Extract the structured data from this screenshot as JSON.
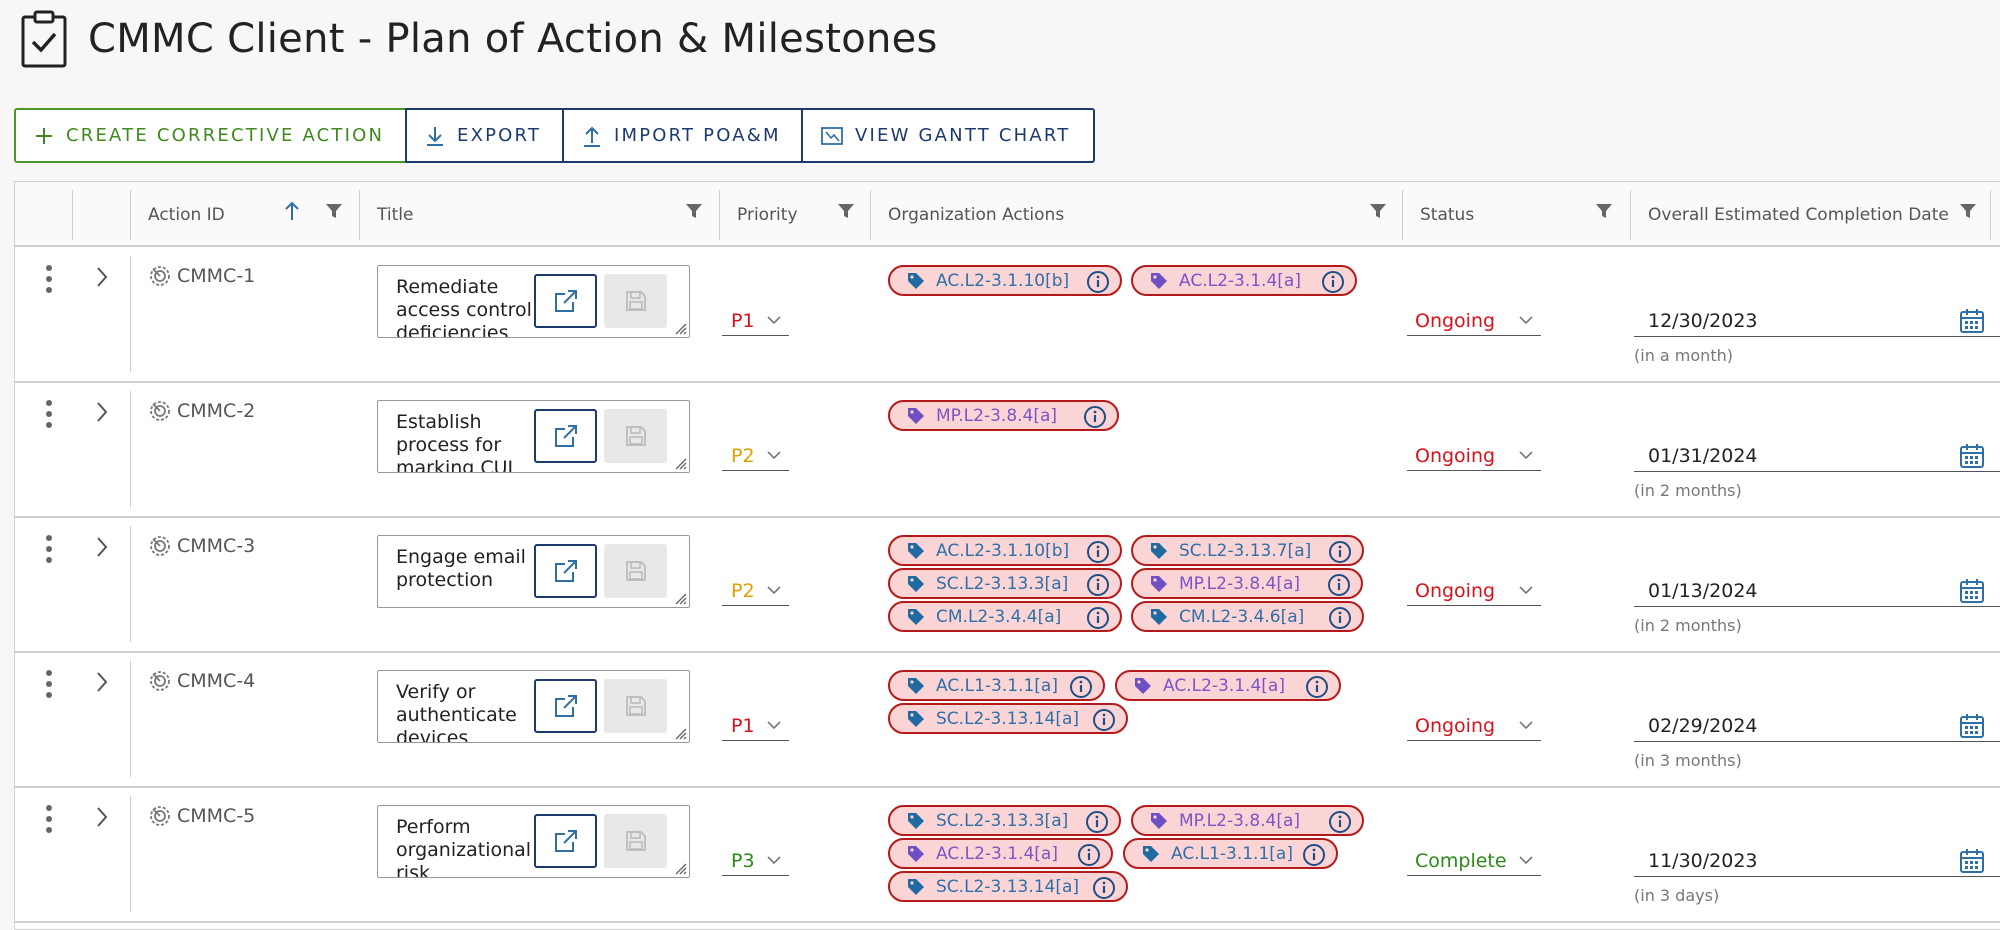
{
  "header": {
    "title": "CMMC Client - Plan of Action & Milestones",
    "icon": "clipboard-check-icon"
  },
  "toolbar": {
    "create_label": "CREATE CORRECTIVE ACTION",
    "export_label": "EXPORT",
    "import_label": "IMPORT POA&M",
    "gantt_label": "VIEW GANTT CHART"
  },
  "columns": {
    "action_id": "Action ID",
    "title": "Title",
    "priority": "Priority",
    "org_actions": "Organization Actions",
    "status": "Status",
    "completion": "Overall Estimated Completion Date"
  },
  "colors": {
    "accent": "#1d3a6e",
    "green": "#3e8a1e",
    "tag_border": "#b51a1a",
    "tag_bg": "#fbd5d5"
  },
  "rows": [
    {
      "id": "CMMC-1",
      "title": "Remediate access control deficiencies",
      "priority": "P1",
      "tags": [
        "AC.L2-3.1.10[b]",
        "AC.L2-3.1.4[a]"
      ],
      "status": "Ongoing",
      "date": "12/30/2023",
      "hint": "(in a month)"
    },
    {
      "id": "CMMC-2",
      "title": "Establish process for marking CUI",
      "priority": "P2",
      "tags": [
        "MP.L2-3.8.4[a]"
      ],
      "status": "Ongoing",
      "date": "01/31/2024",
      "hint": "(in 2 months)"
    },
    {
      "id": "CMMC-3",
      "title": "Engage email protection",
      "priority": "P2",
      "tags": [
        "AC.L2-3.1.10[b]",
        "SC.L2-3.13.7[a]",
        "SC.L2-3.13.3[a]",
        "MP.L2-3.8.4[a]",
        "CM.L2-3.4.4[a]",
        "CM.L2-3.4.6[a]"
      ],
      "status": "Ongoing",
      "date": "01/13/2024",
      "hint": "(in 2 months)"
    },
    {
      "id": "CMMC-4",
      "title": "Verify or authenticate devices",
      "priority": "P1",
      "tags": [
        "AC.L1-3.1.1[a]",
        "AC.L2-3.1.4[a]",
        "SC.L2-3.13.14[a]"
      ],
      "status": "Ongoing",
      "date": "02/29/2024",
      "hint": "(in 3 months)"
    },
    {
      "id": "CMMC-5",
      "title": "Perform organizational risk",
      "priority": "P3",
      "tags": [
        "SC.L2-3.13.3[a]",
        "MP.L2-3.8.4[a]",
        "AC.L2-3.1.4[a]",
        "AC.L1-3.1.1[a]",
        "SC.L2-3.13.14[a]"
      ],
      "status": "Complete",
      "date": "11/30/2023",
      "hint": "(in 3 days)"
    }
  ]
}
